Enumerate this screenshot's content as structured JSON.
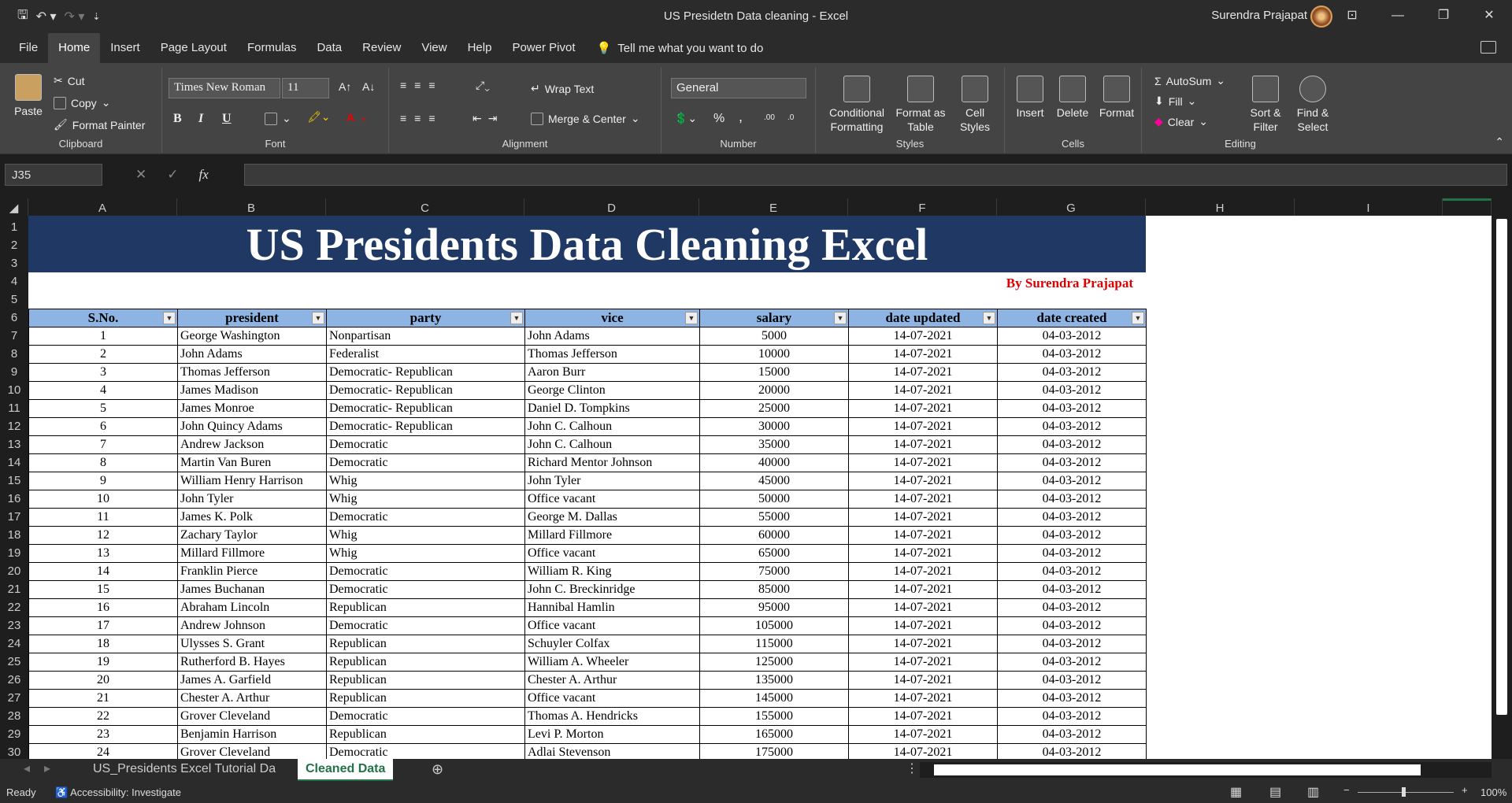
{
  "window": {
    "title": "US Presidetn Data cleaning  -  Excel",
    "user": "Surendra Prajapat"
  },
  "menu": {
    "tabs": [
      "File",
      "Home",
      "Insert",
      "Page Layout",
      "Formulas",
      "Data",
      "Review",
      "View",
      "Help",
      "Power Pivot"
    ],
    "active": "Home",
    "tell_me": "Tell me what you want to do"
  },
  "ribbon": {
    "clipboard": {
      "paste": "Paste",
      "cut": "Cut",
      "copy": "Copy",
      "format_painter": "Format Painter",
      "label": "Clipboard"
    },
    "font": {
      "name": "Times New Roman",
      "size": "11",
      "label": "Font",
      "bold": "B",
      "italic": "I",
      "underline": "U"
    },
    "alignment": {
      "wrap": "Wrap Text",
      "merge": "Merge & Center",
      "label": "Alignment"
    },
    "number": {
      "format": "General",
      "percent": "%",
      "comma": ",",
      "label": "Number"
    },
    "styles": {
      "conditional": "Conditional Formatting",
      "format_table": "Format as Table",
      "cell_styles": "Cell Styles",
      "label": "Styles"
    },
    "cells": {
      "insert": "Insert",
      "delete": "Delete",
      "format": "Format",
      "label": "Cells"
    },
    "editing": {
      "autosum": "AutoSum",
      "fill": "Fill",
      "clear": "Clear",
      "sort": "Sort & Filter",
      "find": "Find & Select",
      "label": "Editing"
    }
  },
  "formula_bar": {
    "name_box": "J35",
    "fx": "fx",
    "content": ""
  },
  "columns": [
    "A",
    "B",
    "C",
    "D",
    "E",
    "F",
    "G",
    "H",
    "I"
  ],
  "rows": [
    "1",
    "2",
    "3",
    "4",
    "5",
    "6",
    "7",
    "8",
    "9",
    "10",
    "11",
    "12",
    "13",
    "14",
    "15",
    "16",
    "17",
    "18",
    "19",
    "20",
    "21",
    "22",
    "23",
    "24",
    "25",
    "26",
    "27",
    "28",
    "29",
    "30"
  ],
  "sheet": {
    "banner": "US Presidents Data Cleaning Excel",
    "byline": "By Surendra Prajapat",
    "headers": [
      "S.No.",
      "president",
      "party",
      "vice",
      "salary",
      "date updated",
      "date created"
    ],
    "data": [
      [
        "1",
        "George Washington",
        "Nonpartisan",
        "John Adams",
        "5000",
        "14-07-2021",
        "04-03-2012"
      ],
      [
        "2",
        "John Adams",
        "Federalist",
        "Thomas Jefferson",
        "10000",
        "14-07-2021",
        "04-03-2012"
      ],
      [
        "3",
        "Thomas Jefferson",
        "Democratic-  Republican",
        "Aaron Burr",
        "15000",
        "14-07-2021",
        "04-03-2012"
      ],
      [
        "4",
        "James Madison",
        "Democratic-  Republican",
        "George Clinton",
        "20000",
        "14-07-2021",
        "04-03-2012"
      ],
      [
        "5",
        "James Monroe",
        "Democratic-  Republican",
        "Daniel D. Tompkins",
        "25000",
        "14-07-2021",
        "04-03-2012"
      ],
      [
        "6",
        "John Quincy Adams",
        "Democratic-  Republican",
        "John C. Calhoun",
        "30000",
        "14-07-2021",
        "04-03-2012"
      ],
      [
        "7",
        "Andrew Jackson",
        "Democratic",
        "John C. Calhoun",
        "35000",
        "14-07-2021",
        "04-03-2012"
      ],
      [
        "8",
        "Martin Van Buren",
        "Democratic",
        "Richard Mentor Johnson",
        "40000",
        "14-07-2021",
        "04-03-2012"
      ],
      [
        "9",
        "William Henry Harrison",
        "Whig",
        "John Tyler",
        "45000",
        "14-07-2021",
        "04-03-2012"
      ],
      [
        "10",
        "John Tyler",
        "Whig",
        "Office vacant",
        "50000",
        "14-07-2021",
        "04-03-2012"
      ],
      [
        "11",
        "James K. Polk",
        "Democratic",
        "George M. Dallas",
        "55000",
        "14-07-2021",
        "04-03-2012"
      ],
      [
        "12",
        "Zachary Taylor",
        "Whig",
        "Millard Fillmore",
        "60000",
        "14-07-2021",
        "04-03-2012"
      ],
      [
        "13",
        "Millard Fillmore",
        "Whig",
        "Office vacant",
        "65000",
        "14-07-2021",
        "04-03-2012"
      ],
      [
        "14",
        "Franklin Pierce",
        "Democratic",
        "William R. King",
        "75000",
        "14-07-2021",
        "04-03-2012"
      ],
      [
        "15",
        "James Buchanan",
        "Democratic",
        "John C. Breckinridge",
        "85000",
        "14-07-2021",
        "04-03-2012"
      ],
      [
        "16",
        "Abraham Lincoln",
        "Republican",
        "Hannibal Hamlin",
        "95000",
        "14-07-2021",
        "04-03-2012"
      ],
      [
        "17",
        "Andrew Johnson",
        "Democratic",
        "Office vacant",
        "105000",
        "14-07-2021",
        "04-03-2012"
      ],
      [
        "18",
        "Ulysses S. Grant",
        "Republican",
        "Schuyler Colfax",
        "115000",
        "14-07-2021",
        "04-03-2012"
      ],
      [
        "19",
        "Rutherford B. Hayes",
        "Republican",
        "William A. Wheeler",
        "125000",
        "14-07-2021",
        "04-03-2012"
      ],
      [
        "20",
        "James A. Garfield",
        "Republican",
        "Chester A. Arthur",
        "135000",
        "14-07-2021",
        "04-03-2012"
      ],
      [
        "21",
        "Chester A. Arthur",
        "Republican",
        "Office vacant",
        "145000",
        "14-07-2021",
        "04-03-2012"
      ],
      [
        "22",
        "Grover Cleveland",
        "Democratic",
        "Thomas A. Hendricks",
        "155000",
        "14-07-2021",
        "04-03-2012"
      ],
      [
        "23",
        "Benjamin Harrison",
        "Republican",
        "Levi P. Morton",
        "165000",
        "14-07-2021",
        "04-03-2012"
      ],
      [
        "24",
        "Grover Cleveland",
        "Democratic",
        "Adlai Stevenson",
        "175000",
        "14-07-2021",
        "04-03-2012"
      ]
    ]
  },
  "sheet_tabs": [
    "US_Presidents Excel Tutorial Da",
    "Cleaned Data"
  ],
  "active_sheet": "Cleaned Data",
  "status": {
    "ready": "Ready",
    "accessibility": "Accessibility: Investigate",
    "zoom": "100%"
  }
}
